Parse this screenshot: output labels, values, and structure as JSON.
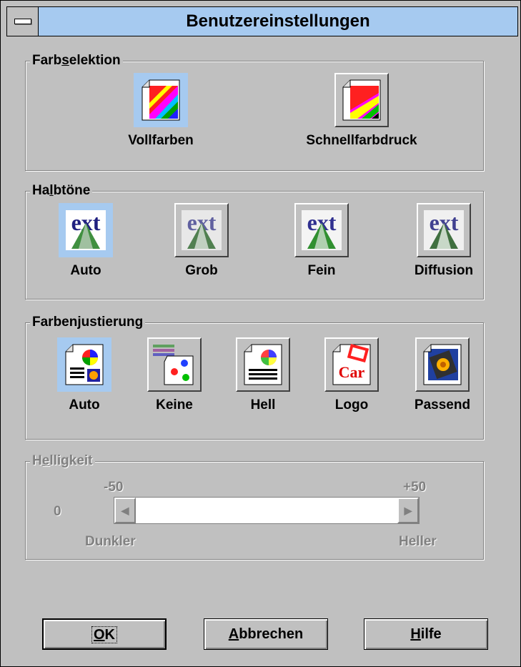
{
  "window": {
    "title": "Benutzereinstellungen"
  },
  "farbselektion": {
    "legend_pre": "Farb",
    "legend_u": "s",
    "legend_post": "elektion",
    "items": [
      {
        "label": "Vollfarben",
        "icon": "full-color-icon",
        "selected": true
      },
      {
        "label": "Schnellfarbdruck",
        "icon": "fast-color-print-icon",
        "selected": false
      }
    ]
  },
  "halbtoene": {
    "legend_pre": "Ha",
    "legend_u": "l",
    "legend_post": "btöne",
    "items": [
      {
        "label": "Auto",
        "icon": "halftone-auto-icon",
        "selected": true
      },
      {
        "label": "Grob",
        "icon": "halftone-coarse-icon",
        "selected": false
      },
      {
        "label": "Fein",
        "icon": "halftone-fine-icon",
        "selected": false
      },
      {
        "label": "Diffusion",
        "icon": "halftone-diffusion-icon",
        "selected": false
      }
    ]
  },
  "farbenjustierung": {
    "legend_pre": "Farben",
    "legend_u": "j",
    "legend_post": "ustierung",
    "items": [
      {
        "label": "Auto",
        "icon": "color-adjust-auto-icon",
        "selected": true
      },
      {
        "label": "Keine",
        "icon": "color-adjust-none-icon",
        "selected": false
      },
      {
        "label": "Hell",
        "icon": "color-adjust-bright-icon",
        "selected": false
      },
      {
        "label": "Logo",
        "icon": "color-adjust-logo-icon",
        "selected": false
      },
      {
        "label": "Passend",
        "icon": "color-adjust-match-icon",
        "selected": false
      }
    ]
  },
  "helligkeit": {
    "legend_pre": "H",
    "legend_u": "e",
    "legend_post": "lligkeit",
    "min_label": "-50",
    "max_label": "+50",
    "value": "0",
    "left_label": "Dunkler",
    "right_label": "Heller",
    "enabled": false
  },
  "buttons": {
    "ok": {
      "u": "O",
      "rest": "K"
    },
    "cancel": {
      "u": "A",
      "rest": "bbrechen"
    },
    "help": {
      "u": "H",
      "rest": "ilfe"
    }
  },
  "colors": {
    "titlebar": "#a6caf0",
    "face": "#c0c0c0",
    "selected": "#a6caf0",
    "disabled_text": "#808080"
  }
}
